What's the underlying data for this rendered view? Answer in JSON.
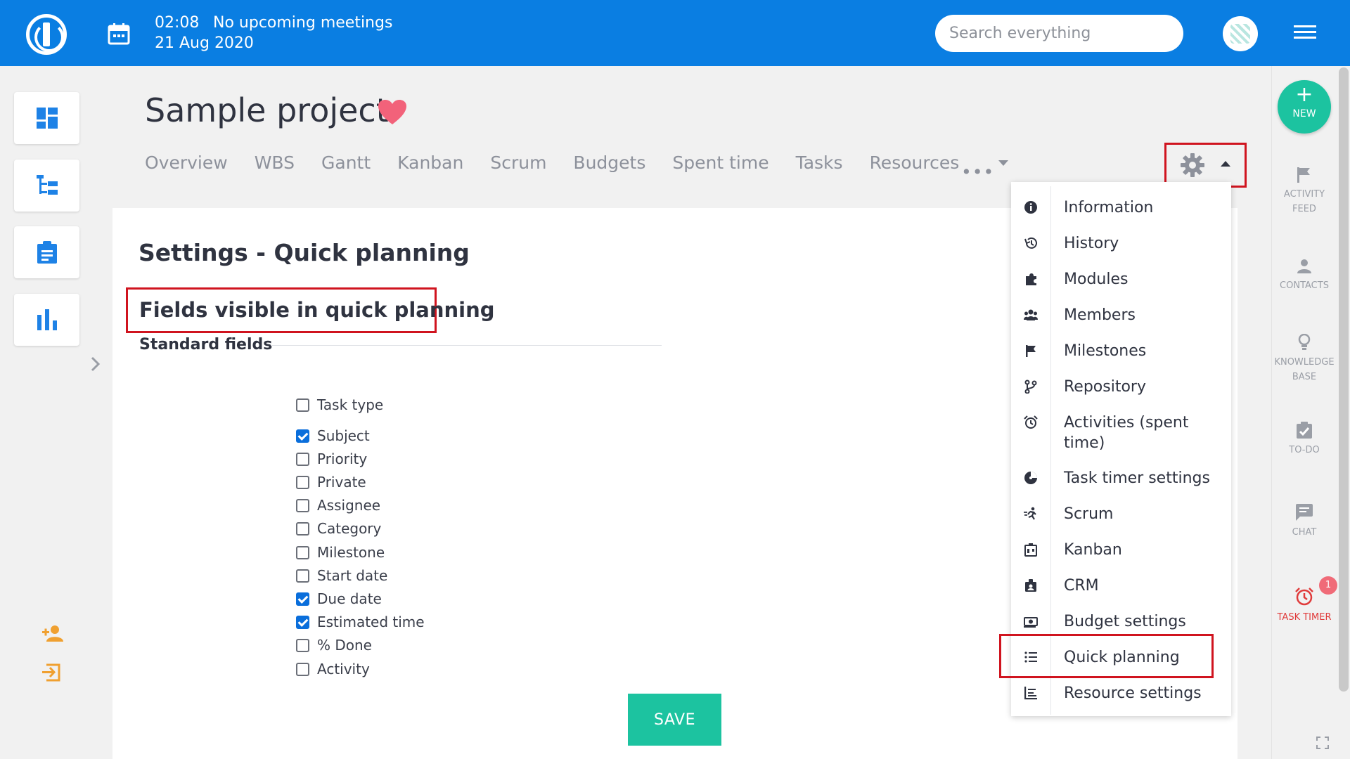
{
  "topbar": {
    "time": "02:08",
    "meeting": "No upcoming meetings",
    "date": "21 Aug 2020",
    "search_placeholder": "Search everything"
  },
  "project": {
    "title": "Sample project",
    "tabs": [
      "Overview",
      "WBS",
      "Gantt",
      "Kanban",
      "Scrum",
      "Budgets",
      "Spent time",
      "Tasks",
      "Resources"
    ],
    "more": "•••"
  },
  "settings": {
    "title": "Settings - Quick planning",
    "section_title": "Fields visible in quick planning",
    "standard_fields_label": "Standard fields",
    "fields": [
      {
        "label": "Task type",
        "checked": false
      },
      {
        "label": "Subject",
        "checked": true
      },
      {
        "label": "Priority",
        "checked": false
      },
      {
        "label": "Private",
        "checked": false
      },
      {
        "label": "Assignee",
        "checked": false
      },
      {
        "label": "Category",
        "checked": false
      },
      {
        "label": "Milestone",
        "checked": false
      },
      {
        "label": "Start date",
        "checked": false
      },
      {
        "label": "Due date",
        "checked": true
      },
      {
        "label": "Estimated time",
        "checked": true
      },
      {
        "label": "% Done",
        "checked": false
      },
      {
        "label": "Activity",
        "checked": false
      }
    ],
    "save_label": "SAVE"
  },
  "menu": {
    "items": [
      {
        "label": "Information",
        "icon": "info-icon"
      },
      {
        "label": "History",
        "icon": "history-icon"
      },
      {
        "label": "Modules",
        "icon": "puzzle-icon"
      },
      {
        "label": "Members",
        "icon": "members-icon"
      },
      {
        "label": "Milestones",
        "icon": "flag-icon"
      },
      {
        "label": "Repository",
        "icon": "branch-icon"
      },
      {
        "label": "Activities (spent time)",
        "icon": "alarm-icon"
      },
      {
        "label": "Task timer settings",
        "icon": "timer-icon"
      },
      {
        "label": "Scrum",
        "icon": "run-icon"
      },
      {
        "label": "Kanban",
        "icon": "kanban-icon"
      },
      {
        "label": "CRM",
        "icon": "crm-icon"
      },
      {
        "label": "Budget settings",
        "icon": "money-icon"
      },
      {
        "label": "Quick planning",
        "icon": "list-icon"
      },
      {
        "label": "Resource settings",
        "icon": "resource-icon"
      }
    ]
  },
  "right_sidebar": {
    "new_label": "NEW",
    "items": [
      {
        "label": "ACTIVITY FEED"
      },
      {
        "label": "CONTACTS"
      },
      {
        "label": "KNOWLEDGE BASE"
      },
      {
        "label": "TO-DO"
      },
      {
        "label": "CHAT"
      },
      {
        "label": "TASK TIMER"
      }
    ],
    "timer_badge": "1"
  },
  "colors": {
    "topbar": "#0a7ee2",
    "accent_green": "#1cc3a0",
    "highlight_red": "#d0141f",
    "checkbox_blue": "#0a6edb",
    "heart": "#f2627a"
  }
}
